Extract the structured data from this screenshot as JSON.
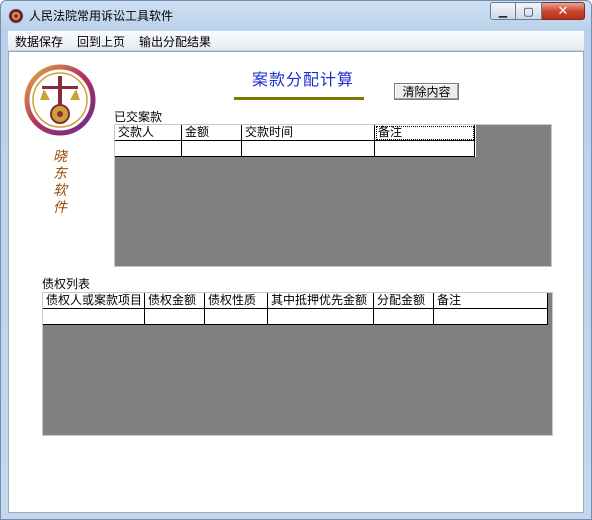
{
  "window": {
    "title": "人民法院常用诉讼工具软件"
  },
  "menu": {
    "items": [
      "数据保存",
      "回到上页",
      "输出分配结果"
    ]
  },
  "logo": {
    "vertical_text": [
      "晓",
      "东",
      "软",
      "件"
    ]
  },
  "page": {
    "title": "案款分配计算",
    "clear_button": "清除内容"
  },
  "payments": {
    "label": "已交案款",
    "columns": [
      "交款人",
      "金额",
      "交款时间",
      "备注"
    ]
  },
  "claims": {
    "label": "债权列表",
    "columns": [
      "债权人或案款项目",
      "债权金额",
      "债权性质",
      "其中抵押优先金额",
      "分配金额",
      "备注"
    ]
  },
  "colors": {
    "title_blue": "#1a2fd0",
    "underline": "#7a7a00",
    "grid_bg": "#808080",
    "signature": "#9a4a00"
  }
}
